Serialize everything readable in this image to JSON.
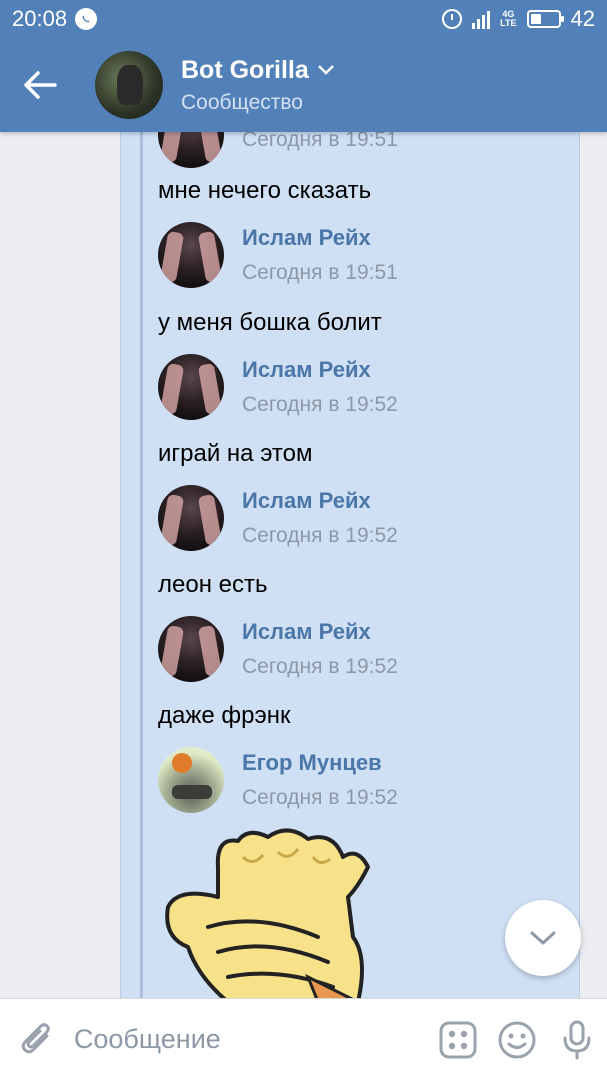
{
  "status_bar": {
    "time": "20:08",
    "network": "4G",
    "network_sub": "LTE",
    "battery": "42",
    "battery_level": 0.42
  },
  "header": {
    "title": "Bot Gorilla",
    "subtitle": "Сообщество"
  },
  "messages": [
    {
      "type": "author",
      "name": "",
      "date": "Сегодня в 19:51",
      "avatar": "islam"
    },
    {
      "type": "text",
      "text": "мне нечего сказать"
    },
    {
      "type": "author",
      "name": "Ислам Рейх",
      "date": "Сегодня в 19:51",
      "avatar": "islam"
    },
    {
      "type": "text",
      "text": "у меня бошка болит"
    },
    {
      "type": "author",
      "name": "Ислам Рейх",
      "date": "Сегодня в 19:52",
      "avatar": "islam"
    },
    {
      "type": "text",
      "text": "играй на этом"
    },
    {
      "type": "author",
      "name": "Ислам Рейх",
      "date": "Сегодня в 19:52",
      "avatar": "islam"
    },
    {
      "type": "text",
      "text": "леон есть"
    },
    {
      "type": "author",
      "name": "Ислам Рейх",
      "date": "Сегодня в 19:52",
      "avatar": "islam"
    },
    {
      "type": "text",
      "text": "даже фрэнк"
    },
    {
      "type": "author",
      "name": "Егор Мунцев",
      "date": "Сегодня в 19:52",
      "avatar": "egor"
    },
    {
      "type": "sticker",
      "sticker": "facepalm-sticker"
    }
  ],
  "input": {
    "placeholder": "Сообщение"
  },
  "icons": {
    "back": "arrow-left-icon",
    "title_dropdown": "chevron-down-icon",
    "scroll_down": "chevron-down-icon",
    "attach": "paperclip-icon",
    "apps": "apps-grid-icon",
    "emoji": "smile-icon",
    "voice": "microphone-icon"
  },
  "colors": {
    "accent": "#5181b8",
    "author_name": "#4a76a8",
    "selected_bg": "#cfe0f5",
    "chat_bg": "#ebedf0",
    "date_text": "#8d98a6"
  }
}
